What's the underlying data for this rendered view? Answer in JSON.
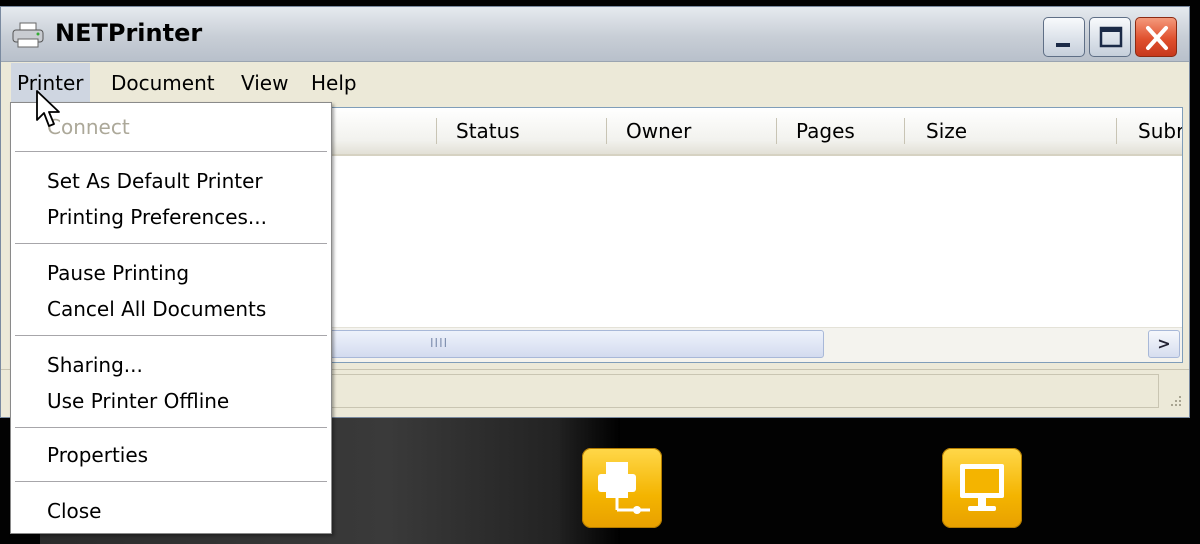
{
  "window": {
    "title": "NETPrinter"
  },
  "menubar": {
    "items": [
      {
        "label": "Printer"
      },
      {
        "label": "Document"
      },
      {
        "label": "View"
      },
      {
        "label": "Help"
      }
    ]
  },
  "list": {
    "columns": [
      "Status",
      "Owner",
      "Pages",
      "Size",
      "Subr"
    ]
  },
  "printer_menu": {
    "items": [
      {
        "label": "Connect",
        "enabled": false
      },
      {
        "label": "Set As Default Printer",
        "enabled": true
      },
      {
        "label": "Printing Preferences...",
        "enabled": true
      },
      {
        "label": "Pause Printing",
        "enabled": true
      },
      {
        "label": "Cancel All Documents",
        "enabled": true
      },
      {
        "label": "Sharing...",
        "enabled": true
      },
      {
        "label": "Use Printer Offline",
        "enabled": true
      },
      {
        "label": "Properties",
        "enabled": true
      },
      {
        "label": "Close",
        "enabled": true
      }
    ]
  },
  "scrollbar": {
    "grip": "IIII",
    "right_arrow": ">"
  },
  "icons": {
    "app": "printer-icon",
    "tile_1": "network-printer-icon",
    "tile_2": "computer-monitor-icon"
  },
  "colors": {
    "tile": "#F4B400",
    "close_button": "#E0502E",
    "menu_highlight": "#CFD6E1"
  }
}
